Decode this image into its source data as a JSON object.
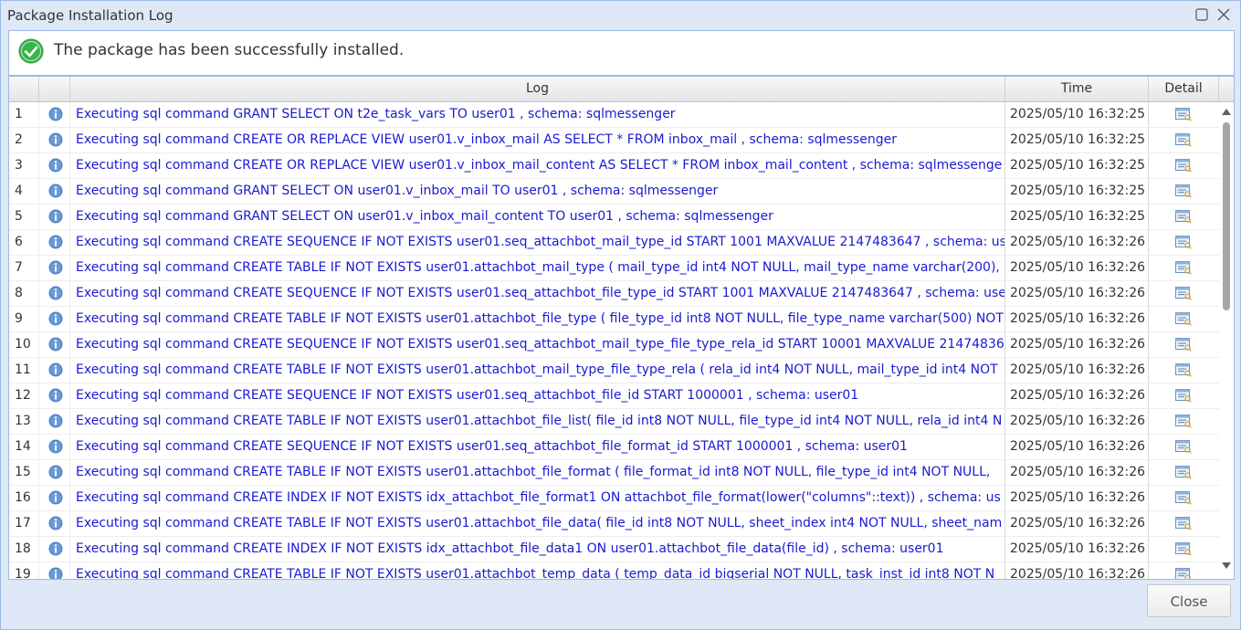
{
  "window": {
    "title": "Package Installation Log"
  },
  "success": {
    "message": "The package has been successfully installed.",
    "icon": "check-circle-icon",
    "color": "#3bb34a"
  },
  "grid": {
    "columns": {
      "log": "Log",
      "time": "Time",
      "detail": "Detail"
    },
    "rows": [
      {
        "num": "1",
        "log": "Executing sql command GRANT SELECT ON t2e_task_vars TO user01 , schema: sqlmessenger",
        "time": "2025/05/10 16:32:25"
      },
      {
        "num": "2",
        "log": "Executing sql command CREATE OR REPLACE VIEW user01.v_inbox_mail AS SELECT * FROM inbox_mail , schema: sqlmessenger",
        "time": "2025/05/10 16:32:25"
      },
      {
        "num": "3",
        "log": "Executing sql command CREATE OR REPLACE VIEW user01.v_inbox_mail_content AS SELECT * FROM inbox_mail_content , schema: sqlmessenge",
        "time": "2025/05/10 16:32:25"
      },
      {
        "num": "4",
        "log": "Executing sql command GRANT SELECT ON user01.v_inbox_mail TO user01 , schema: sqlmessenger",
        "time": "2025/05/10 16:32:25"
      },
      {
        "num": "5",
        "log": "Executing sql command GRANT SELECT ON user01.v_inbox_mail_content TO user01 , schema: sqlmessenger",
        "time": "2025/05/10 16:32:25"
      },
      {
        "num": "6",
        "log": "Executing sql command CREATE SEQUENCE IF NOT EXISTS user01.seq_attachbot_mail_type_id START 1001 MAXVALUE 2147483647 , schema: us",
        "time": "2025/05/10 16:32:26"
      },
      {
        "num": "7",
        "log": "Executing sql command CREATE TABLE IF NOT EXISTS user01.attachbot_mail_type ( mail_type_id int4 NOT NULL, mail_type_name varchar(200),",
        "time": "2025/05/10 16:32:26"
      },
      {
        "num": "8",
        "log": "Executing sql command CREATE SEQUENCE IF NOT EXISTS user01.seq_attachbot_file_type_id START 1001 MAXVALUE 2147483647 , schema: use",
        "time": "2025/05/10 16:32:26"
      },
      {
        "num": "9",
        "log": "Executing sql command CREATE TABLE IF NOT EXISTS user01.attachbot_file_type ( file_type_id int8 NOT NULL, file_type_name varchar(500) NOT",
        "time": "2025/05/10 16:32:26"
      },
      {
        "num": "10",
        "log": "Executing sql command CREATE SEQUENCE IF NOT EXISTS user01.seq_attachbot_mail_type_file_type_rela_id START 10001 MAXVALUE 21474836",
        "time": "2025/05/10 16:32:26"
      },
      {
        "num": "11",
        "log": "Executing sql command CREATE TABLE IF NOT EXISTS user01.attachbot_mail_type_file_type_rela ( rela_id int4 NOT NULL, mail_type_id int4 NOT",
        "time": "2025/05/10 16:32:26"
      },
      {
        "num": "12",
        "log": "Executing sql command CREATE SEQUENCE IF NOT EXISTS user01.seq_attachbot_file_id START 1000001 , schema: user01",
        "time": "2025/05/10 16:32:26"
      },
      {
        "num": "13",
        "log": "Executing sql command CREATE TABLE IF NOT EXISTS user01.attachbot_file_list( file_id int8 NOT NULL, file_type_id int4 NOT NULL, rela_id int4 N",
        "time": "2025/05/10 16:32:26"
      },
      {
        "num": "14",
        "log": "Executing sql command CREATE SEQUENCE IF NOT EXISTS user01.seq_attachbot_file_format_id START 1000001 , schema: user01",
        "time": "2025/05/10 16:32:26"
      },
      {
        "num": "15",
        "log": "Executing sql command CREATE TABLE IF NOT EXISTS user01.attachbot_file_format ( file_format_id int8 NOT NULL, file_type_id int4 NOT NULL,",
        "time": "2025/05/10 16:32:26"
      },
      {
        "num": "16",
        "log": "Executing sql command CREATE INDEX IF NOT EXISTS idx_attachbot_file_format1 ON attachbot_file_format(lower(\"columns\"::text)) , schema: us",
        "time": "2025/05/10 16:32:26"
      },
      {
        "num": "17",
        "log": "Executing sql command CREATE TABLE IF NOT EXISTS user01.attachbot_file_data( file_id int8 NOT NULL, sheet_index int4 NOT NULL, sheet_nam",
        "time": "2025/05/10 16:32:26"
      },
      {
        "num": "18",
        "log": "Executing sql command CREATE INDEX IF NOT EXISTS idx_attachbot_file_data1 ON user01.attachbot_file_data(file_id) , schema: user01",
        "time": "2025/05/10 16:32:26"
      },
      {
        "num": "19",
        "log": "Executing sql command CREATE TABLE IF NOT EXISTS user01.attachbot_temp_data ( temp_data_id bigserial NOT NULL, task_inst_id int8 NOT N",
        "time": "2025/05/10 16:32:26"
      }
    ]
  },
  "footer": {
    "close_label": "Close"
  },
  "colors": {
    "log_text": "#1a1ad0",
    "info_icon": "#4a7fc4",
    "border": "#99bbe8"
  }
}
